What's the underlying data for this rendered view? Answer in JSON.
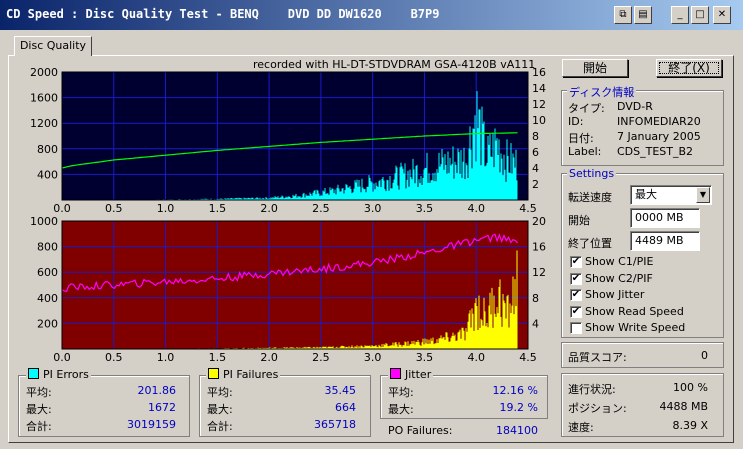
{
  "window": {
    "title": "CD Speed : Disc Quality Test - BENQ    DVD DD DW1620    B7P9"
  },
  "tab": {
    "label": "Disc Quality"
  },
  "recorded_with": "recorded with HL-DT-STDVDRAM GSA-4120B vA111",
  "buttons": {
    "start": "開始",
    "end": "終了(X)"
  },
  "disc_info": {
    "title": "ディスク情報",
    "type_label": "タイプ:",
    "type_value": "DVD-R",
    "id_label": "ID:",
    "id_value": "INFOMEDIAR20",
    "date_label": "日付:",
    "date_value": "7 January 2005",
    "label_label": "Label:",
    "label_value": "CDS_TEST_B2"
  },
  "settings": {
    "title": "Settings",
    "speed_label": "転送速度",
    "speed_value": "最大",
    "start_label": "開始",
    "start_value": "0000 MB",
    "end_label": "終了位置",
    "end_value": "4489 MB",
    "checks": [
      {
        "label": "Show C1/PIE",
        "checked": true
      },
      {
        "label": "Show C2/PIF",
        "checked": true
      },
      {
        "label": "Show Jitter",
        "checked": true
      },
      {
        "label": "Show Read Speed",
        "checked": true
      },
      {
        "label": "Show Write Speed",
        "checked": false
      }
    ]
  },
  "quality": {
    "label": "品質スコア:",
    "value": "0"
  },
  "progress": {
    "status_label": "進行状況:",
    "status_value": "100 %",
    "position_label": "ポジション:",
    "position_value": "4488 MB",
    "speed_label": "速度:",
    "speed_value": "8.39 X"
  },
  "stats": {
    "pie": {
      "title": "PI Errors",
      "color": "#00ffff",
      "avg_label": "平均:",
      "avg": "201.86",
      "max_label": "最大:",
      "max": "1672",
      "total_label": "合計:",
      "total": "3019159"
    },
    "pif": {
      "title": "PI Failures",
      "color": "#ffff00",
      "avg_label": "平均:",
      "avg": "35.45",
      "max_label": "最大:",
      "max": "664",
      "total_label": "合計:",
      "total": "365718"
    },
    "jitter": {
      "title": "Jitter",
      "color": "#ff00ff",
      "avg_label": "平均:",
      "avg": "12.16 %",
      "max_label": "最大:",
      "max": "19.2 %"
    },
    "po_label": "PO Failures:",
    "po_value": "184100"
  },
  "chart_data": [
    {
      "type": "area",
      "x_ticks": [
        "0.0",
        "0.5",
        "1.0",
        "1.5",
        "2.0",
        "2.5",
        "3.0",
        "3.5",
        "4.0",
        "4.5"
      ],
      "xlim": [
        0,
        4.5
      ],
      "y_left_ticks": [
        "2000",
        "1600",
        "1200",
        "800",
        "400"
      ],
      "ylim_left": [
        0,
        2000
      ],
      "y_right_ticks": [
        "16",
        "14",
        "12",
        "10",
        "8",
        "6",
        "4",
        "2"
      ],
      "ylim_right": [
        0,
        16
      ],
      "background": "#000030",
      "series": [
        {
          "color": "#00ffff",
          "x": [
            0,
            0.5,
            1.0,
            1.5,
            2.0,
            2.3,
            2.6,
            3.0,
            3.3,
            3.6,
            3.9,
            4.0,
            4.1,
            4.2,
            4.3,
            4.4
          ],
          "values": [
            0,
            0,
            10,
            20,
            40,
            90,
            170,
            330,
            480,
            660,
            800,
            1672,
            820,
            1100,
            760,
            700
          ]
        },
        {
          "color": "#00ff00",
          "x": [
            0,
            0.1,
            0.5,
            1.0,
            1.5,
            2.0,
            2.5,
            3.0,
            3.5,
            4.0,
            4.4
          ],
          "values": [
            4.0,
            4.3,
            5.0,
            5.6,
            6.2,
            6.7,
            7.2,
            7.6,
            8.0,
            8.3,
            8.4
          ]
        }
      ]
    },
    {
      "type": "area",
      "x_ticks": [
        "0.0",
        "0.5",
        "1.0",
        "1.5",
        "2.0",
        "2.5",
        "3.0",
        "3.5",
        "4.0",
        "4.5"
      ],
      "xlim": [
        0,
        4.5
      ],
      "y_left_ticks": [
        "1000",
        "800",
        "600",
        "400",
        "200"
      ],
      "ylim_left": [
        0,
        1000
      ],
      "y_right_ticks": [
        "20",
        "16",
        "12",
        "8",
        "4"
      ],
      "ylim_right": [
        0,
        20
      ],
      "background": "#800000",
      "series": [
        {
          "color": "#ffff00",
          "x": [
            0,
            0.5,
            1.0,
            1.5,
            2.0,
            2.5,
            3.0,
            3.3,
            3.6,
            3.9,
            4.0,
            4.1,
            4.2,
            4.3,
            4.4
          ],
          "values": [
            0,
            0,
            2,
            5,
            10,
            15,
            30,
            50,
            80,
            150,
            420,
            300,
            550,
            330,
            664
          ]
        },
        {
          "color": "#ff00ff",
          "x": [
            0,
            0.5,
            1.0,
            1.5,
            2.0,
            2.5,
            3.0,
            3.5,
            4.0,
            4.2,
            4.4
          ],
          "values": [
            9.5,
            10.0,
            10.5,
            11.0,
            11.8,
            12.5,
            13.5,
            15.0,
            17.0,
            17.5,
            16.5
          ]
        }
      ]
    }
  ]
}
